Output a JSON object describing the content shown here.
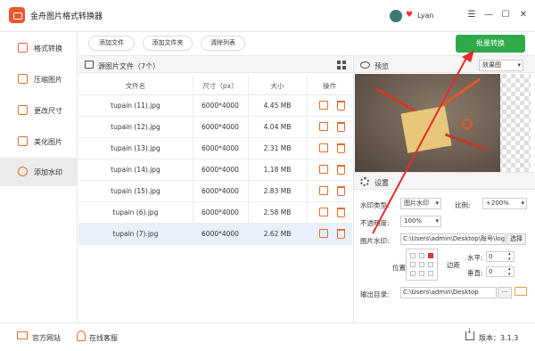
{
  "app": {
    "title": "金舟图片格式转换器"
  },
  "user": {
    "name": "Lyan"
  },
  "window": {
    "minimize": "—",
    "maximize": "☐",
    "close": "✕",
    "menu": "☰"
  },
  "sidebar": {
    "items": [
      {
        "label": "格式转换"
      },
      {
        "label": "压缩图片"
      },
      {
        "label": "更改尺寸"
      },
      {
        "label": "美化图片"
      },
      {
        "label": "添加水印"
      }
    ]
  },
  "toolbar": {
    "add_file": "添加文件",
    "add_folder": "添加文件夹",
    "clear_list": "清除列表",
    "batch_convert": "批量转换"
  },
  "files": {
    "title": "源图片文件（7个）",
    "headers": {
      "name": "文件名",
      "size_px": "尺寸（px）",
      "filesize": "大小",
      "ops": "操作"
    },
    "rows": [
      {
        "name": "tupain (11).jpg",
        "dims": "6000*4000",
        "size": "4.45 MB"
      },
      {
        "name": "tupain (12).jpg",
        "dims": "6000*4000",
        "size": "4.04 MB"
      },
      {
        "name": "tupain (13).jpg",
        "dims": "6000*4000",
        "size": "2.31 MB"
      },
      {
        "name": "tupain (14).jpg",
        "dims": "6000*4000",
        "size": "1.18 MB"
      },
      {
        "name": "tupain (15).jpg",
        "dims": "6000*4000",
        "size": "2.83 MB"
      },
      {
        "name": "tupain (6).jpg",
        "dims": "6000*4000",
        "size": "2.58 MB"
      },
      {
        "name": "tupain (7).jpg",
        "dims": "6000*4000",
        "size": "2.62 MB"
      }
    ]
  },
  "preview": {
    "label": "预览",
    "mode": "效果图"
  },
  "settings": {
    "label": "设置",
    "watermark_type_label": "水印类型:",
    "watermark_type": "图片水印",
    "scale_label": "比例:",
    "scale": "+200%",
    "opacity_label": "不透明度:",
    "opacity": "100%",
    "image_label": "图片水印:",
    "image_path": "C:\\Users\\admin\\Desktop\\账号\\logo",
    "choose": "选择",
    "position_label": "位置",
    "margin_label": "边距",
    "horizontal_label": "水平:",
    "horizontal": "0",
    "vertical_label": "垂直:",
    "vertical": "0",
    "output_label": "输出目录:",
    "output_path": "C:\\Users\\admin\\Desktop",
    "more": "···"
  },
  "footer": {
    "website": "官方网站",
    "support": "在线客服",
    "version": "版本：3.1.3"
  },
  "colors": {
    "accent": "#e86a2e",
    "primary_button": "#2eaa4a",
    "arrow": "#e52d2d"
  }
}
